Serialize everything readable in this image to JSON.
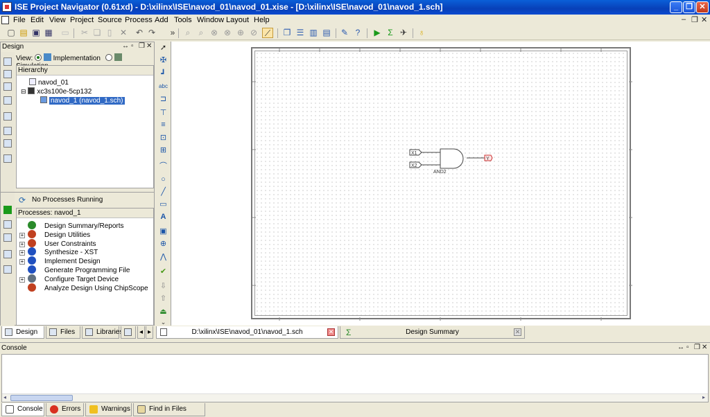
{
  "window": {
    "title": "ISE Project Navigator (0.61xd) - D:\\xilinx\\ISE\\navod_01\\navod_01.xise - [D:\\xilinx\\ISE\\navod_01\\navod_1.sch]"
  },
  "menu": [
    "File",
    "Edit",
    "View",
    "Project",
    "Source",
    "Process",
    "Add",
    "Tools",
    "Window",
    "Layout",
    "Help"
  ],
  "design_panel": {
    "title": "Design",
    "view_label": "View:",
    "view_implementation": "Implementation",
    "view_simulation": "Simulation",
    "hierarchy_label": "Hierarchy",
    "tree": [
      {
        "label": "navod_01"
      },
      {
        "label": "xc3s100e-5cp132"
      },
      {
        "label": "navod_1 (navod_1.sch)"
      }
    ],
    "process_status": "No Processes Running",
    "processes_label": "Processes: navod_1",
    "processes": [
      {
        "label": "Design Summary/Reports",
        "color": "#2a8a2a"
      },
      {
        "label": "Design Utilities",
        "color": "#c04020"
      },
      {
        "label": "User Constraints",
        "color": "#c04020"
      },
      {
        "label": "Synthesize - XST",
        "color": "#2050c0"
      },
      {
        "label": "Implement Design",
        "color": "#2050c0"
      },
      {
        "label": "Generate Programming File",
        "color": "#2050c0"
      },
      {
        "label": "Configure Target Device",
        "color": "#607080"
      },
      {
        "label": "Analyze Design Using ChipScope",
        "color": "#c04020"
      }
    ],
    "tabs": [
      "Design",
      "Files",
      "Libraries"
    ]
  },
  "schematic": {
    "inputs": [
      "X1",
      "X2"
    ],
    "gate_label": "AND2",
    "output": "Y"
  },
  "editor_tabs": [
    {
      "label": "D:\\xilinx\\ISE\\navod_01\\navod_1.sch"
    },
    {
      "label": "Design Summary"
    }
  ],
  "console": {
    "title": "Console",
    "tabs": [
      "Console",
      "Errors",
      "Warnings",
      "Find in Files Results"
    ]
  }
}
